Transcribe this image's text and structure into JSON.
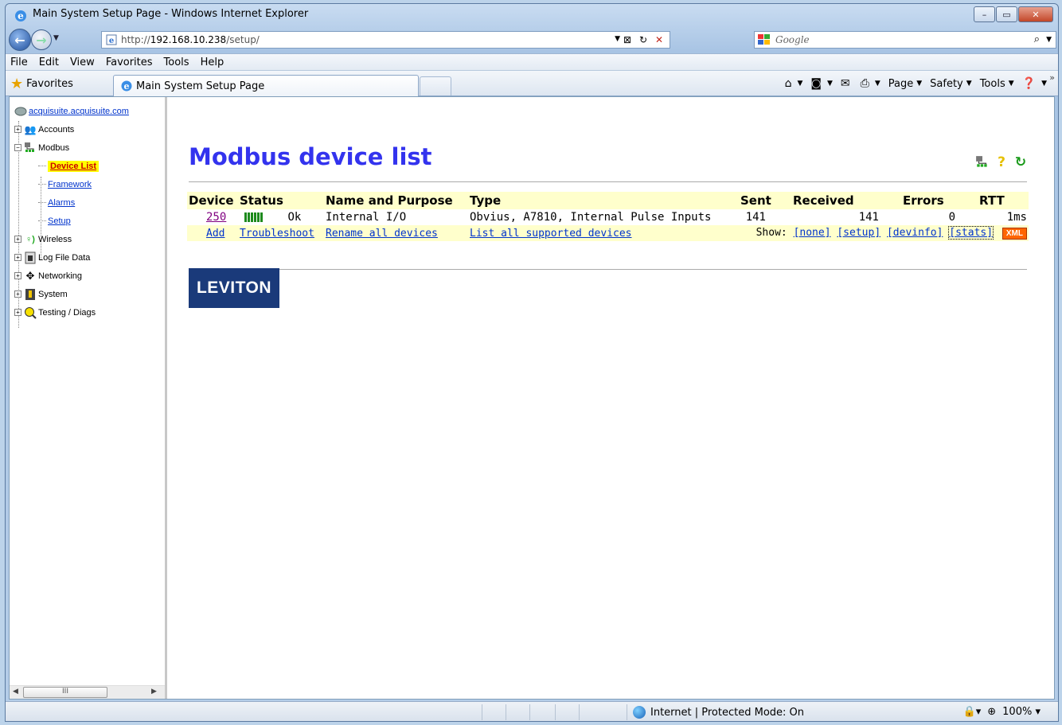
{
  "window": {
    "title": "Main System Setup Page - Windows Internet Explorer",
    "minimize": "–",
    "maximize": "▭",
    "close": "✕"
  },
  "address": {
    "url_prefix": "http://",
    "url_host": "192.168.10.238",
    "url_path": "/setup/",
    "search_placeholder": "Google"
  },
  "menu": {
    "items": [
      {
        "label": "File",
        "key": "F"
      },
      {
        "label": "Edit",
        "key": "E"
      },
      {
        "label": "View",
        "key": "V"
      },
      {
        "label": "Favorites",
        "key": "a"
      },
      {
        "label": "Tools",
        "key": "T"
      },
      {
        "label": "Help",
        "key": "H"
      }
    ]
  },
  "favbar": {
    "favorites_label": "Favorites",
    "tab_title": "Main System Setup Page",
    "page_label": "Page",
    "safety_label": "Safety",
    "tools_label": "Tools"
  },
  "sidebar": {
    "root": "acquisuite.acquisuite.com",
    "accounts": "Accounts",
    "modbus": "Modbus",
    "device_list": "Device List",
    "framework": "Framework",
    "alarms": "Alarms",
    "setup": "Setup",
    "wireless": "Wireless",
    "log_file_data": "Log File Data",
    "networking": "Networking",
    "system": "System",
    "testing": "Testing / Diags",
    "scroll_thumb": "III"
  },
  "main": {
    "title": "Modbus device list",
    "columns": {
      "device": "Device",
      "status": "Status",
      "name": "Name and Purpose",
      "type": "Type",
      "sent": "Sent",
      "received": "Received",
      "errors": "Errors",
      "rtt": "RTT"
    },
    "row": {
      "device": "250",
      "status": "Ok",
      "name": "Internal I/O",
      "type": "Obvius, A7810, Internal Pulse Inputs",
      "sent": "141",
      "received": "141",
      "errors": "0",
      "rtt": "1ms"
    },
    "actions": {
      "add": "Add",
      "troubleshoot": "Troubleshoot",
      "rename": "Rename all devices",
      "list_supported": "List all supported devices",
      "show_label": "Show:",
      "none": "[none]",
      "setup": "[setup]",
      "devinfo": "[devinfo]",
      "stats": "[stats]",
      "xml": "XML"
    },
    "logo_text": "LEVITON"
  },
  "statusbar": {
    "zone": "Internet | Protected Mode: On",
    "zoom": "100%"
  }
}
